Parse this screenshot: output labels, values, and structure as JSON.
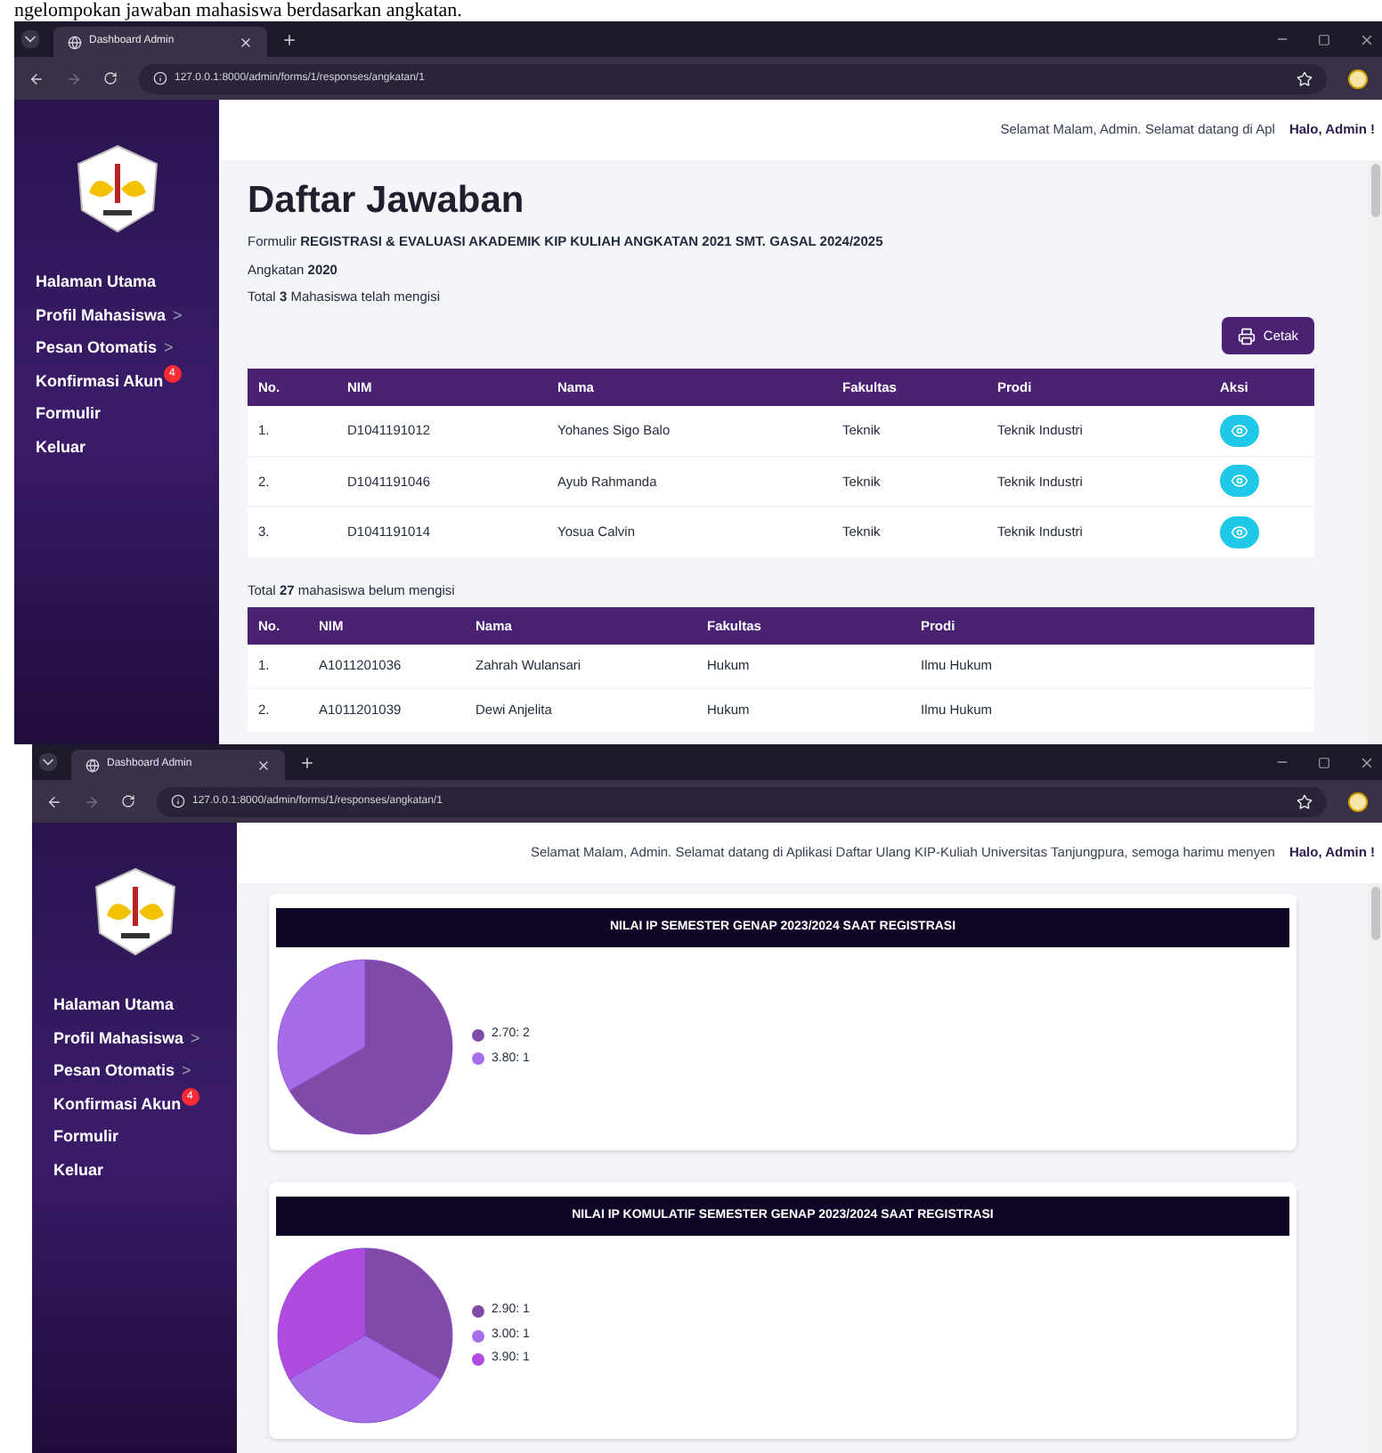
{
  "caption": "ngelompokan jawaban mahasiswa berdasarkan angkatan.",
  "screens": [
    {
      "kind": "responses",
      "tab_title": "Dashboard Admin",
      "url": "127.0.0.1:8000/admin/forms/1/responses/angkatan/1",
      "greeting": "Selamat Malam, Admin. Selamat datang di Apl",
      "user": "Halo, Admin !",
      "sidebar": [
        {
          "label": "Halaman Utama"
        },
        {
          "label": "Profil Mahasiswa",
          "chevron": ">"
        },
        {
          "label": "Pesan Otomatis",
          "chevron": ">"
        },
        {
          "label": "Konfirmasi Akun",
          "badge": "4"
        },
        {
          "label": "Formulir"
        },
        {
          "label": "Keluar"
        }
      ],
      "title": "Daftar Jawaban",
      "form_line": "Formulir **REGISTRASI & EVALUASI AKADEMIK KIP KULIAH ANGKATAN 2021 SMT. GASAL 2024/2025**",
      "angkatan_line": "Angkatan **2020**",
      "filled_line": "Total **3** Mahasiswa telah mengisi",
      "print_button": "Cetak",
      "filled_table": {
        "columns": [
          "No.",
          "NIM",
          "Nama",
          "Fakultas",
          "Prodi",
          "Aksi"
        ],
        "rows": [
          [
            "1.",
            "D1041191012",
            "Yohanes Sigo Balo",
            "Teknik",
            "Teknik Industri"
          ],
          [
            "2.",
            "D1041191046",
            "Ayub Rahmanda",
            "Teknik",
            "Teknik Industri"
          ],
          [
            "3.",
            "D1041191014",
            "Yosua Calvin",
            "Teknik",
            "Teknik Industri"
          ]
        ]
      },
      "unfilled_line": "Total **27** mahasiswa belum mengisi",
      "unfilled_table": {
        "columns": [
          "No.",
          "NIM",
          "Nama",
          "Fakultas",
          "Prodi"
        ],
        "rows": [
          [
            "1.",
            "A1011201036",
            "Zahrah Wulansari",
            "Hukum",
            "Ilmu Hukum"
          ],
          [
            "2.",
            "A1011201039",
            "Dewi Anjelita",
            "Hukum",
            "Ilmu Hukum"
          ]
        ]
      }
    },
    {
      "kind": "charts",
      "tab_title": "Dashboard Admin",
      "url": "127.0.0.1:8000/admin/forms/1/responses/angkatan/1",
      "greeting": "Selamat Malam, Admin. Selamat datang di Aplikasi Daftar Ulang KIP-Kuliah Universitas Tanjungpura, semoga harimu menyen",
      "user": "Halo, Admin !",
      "sidebar": [
        {
          "label": "Halaman Utama"
        },
        {
          "label": "Profil Mahasiswa",
          "chevron": ">"
        },
        {
          "label": "Pesan Otomatis",
          "chevron": ">"
        },
        {
          "label": "Konfirmasi Akun",
          "badge": "4"
        },
        {
          "label": "Formulir"
        },
        {
          "label": "Keluar"
        }
      ],
      "cards": [
        {
          "title": "NILAI IP SEMESTER GENAP 2023/2024 SAAT REGISTRASI",
          "chart_data": {
            "type": "pie",
            "categories": [
              "2.70: 2",
              "3.80: 1"
            ],
            "values": [
              2,
              1
            ],
            "colors": [
              "#7f4ba6",
              "#a66de8"
            ]
          }
        },
        {
          "title": "NILAI IP KOMULATIF SEMESTER GENAP 2023/2024 SAAT REGISTRASI",
          "chart_data": {
            "type": "pie",
            "categories": [
              "2.90: 1",
              "3.00: 1",
              "3.90: 1"
            ],
            "values": [
              1,
              1,
              1
            ],
            "colors": [
              "#7f4ba6",
              "#a66de8",
              "#b04ae0"
            ]
          }
        }
      ]
    }
  ]
}
